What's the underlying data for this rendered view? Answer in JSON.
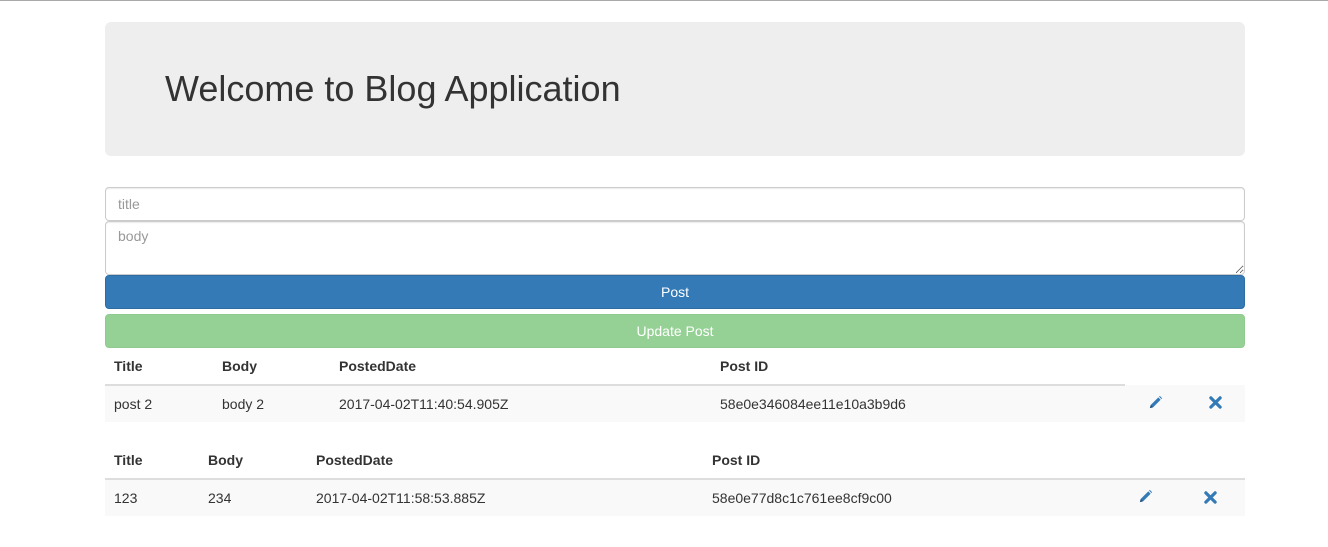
{
  "header": {
    "title": "Welcome to Blog Application"
  },
  "form": {
    "title_placeholder": "title",
    "body_placeholder": "body",
    "post_button": "Post",
    "update_button": "Update Post"
  },
  "columns": {
    "title": "Title",
    "body": "Body",
    "posted_date": "PostedDate",
    "post_id": "Post ID"
  },
  "posts": [
    {
      "title": "post 2",
      "body": "body 2",
      "posted_date": "2017-04-02T11:40:54.905Z",
      "post_id": "58e0e346084ee11e10a3b9d6",
      "edit_icon": "pencil-icon",
      "delete_icon": "close-icon"
    },
    {
      "title": "123",
      "body": "234",
      "posted_date": "2017-04-02T11:58:53.885Z",
      "post_id": "58e0e77d8c1c761ee8cf9c00",
      "edit_icon": "pencil-icon",
      "delete_icon": "close-icon"
    }
  ],
  "colors": {
    "primary": "#337ab7",
    "success_disabled": "#95d195",
    "jumbotron": "#eeeeee"
  }
}
